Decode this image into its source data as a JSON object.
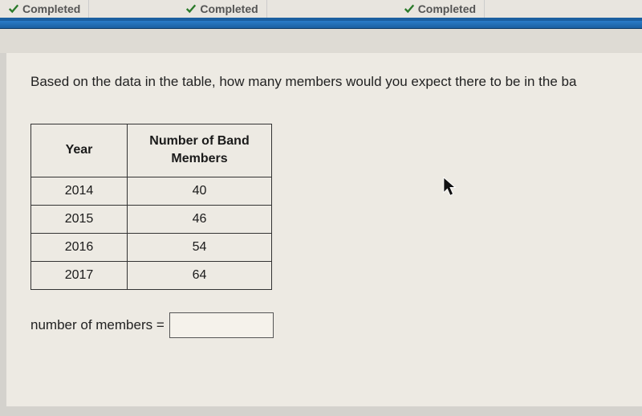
{
  "tabs": [
    {
      "label": "Completed"
    },
    {
      "label": "Completed"
    },
    {
      "label": "Completed"
    }
  ],
  "question": "Based on the data in the table, how many members would you expect there to be in the ba",
  "table": {
    "headers": {
      "year": "Year",
      "members": "Number of Band Members"
    },
    "rows": [
      {
        "year": "2014",
        "members": "40"
      },
      {
        "year": "2015",
        "members": "46"
      },
      {
        "year": "2016",
        "members": "54"
      },
      {
        "year": "2017",
        "members": "64"
      }
    ]
  },
  "answer": {
    "label": "number of members =",
    "value": ""
  }
}
